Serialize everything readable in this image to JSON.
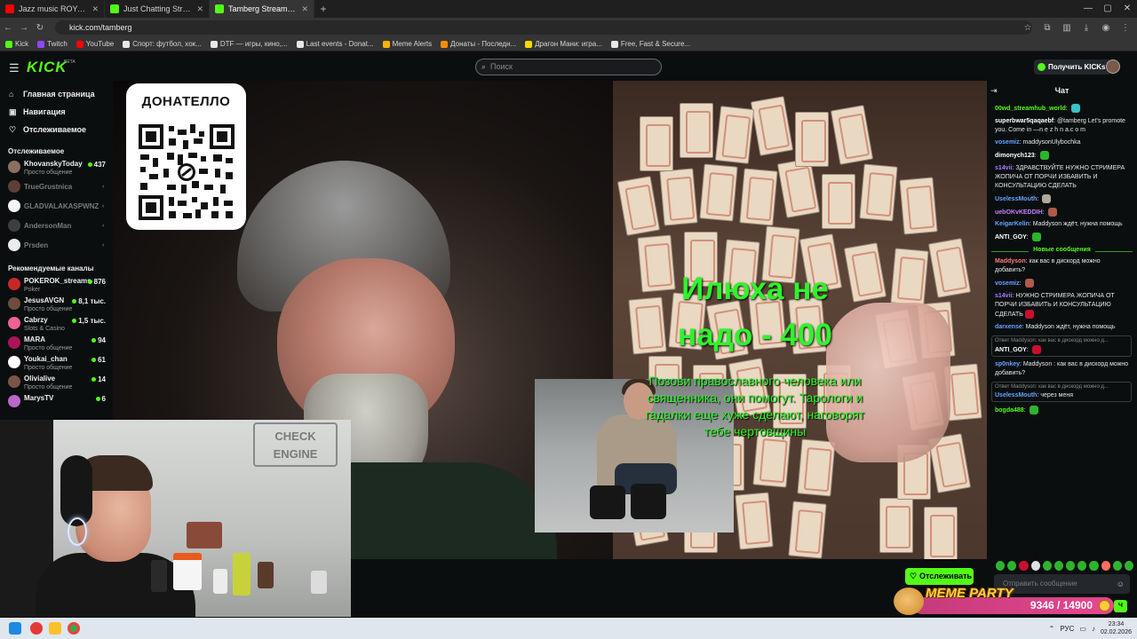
{
  "browser": {
    "tabs": [
      {
        "label": "Jazz music ROYALTY FREE I",
        "color": "#ff0000",
        "active": false
      },
      {
        "label": "Just Chatting Streaming - Live",
        "color": "#53fc18",
        "active": false
      },
      {
        "label": "Tamberg Stream - Watch Li",
        "color": "#53fc18",
        "active": true
      }
    ],
    "url": "kick.com/tamberg",
    "bookmarks": [
      {
        "label": "Kick",
        "color": "#53fc18"
      },
      {
        "label": "Twitch",
        "color": "#9146ff"
      },
      {
        "label": "YouTube",
        "color": "#ff0000"
      },
      {
        "label": "Спорт: футбол, хок...",
        "color": "#e8e8e8"
      },
      {
        "label": "DTF — игры, кино,...",
        "color": "#e8e8e8"
      },
      {
        "label": "Last events - Donat...",
        "color": "#e8e8e8"
      },
      {
        "label": "Meme Alerts",
        "color": "#ffb300"
      },
      {
        "label": "Донаты - Последн...",
        "color": "#ff8c00"
      },
      {
        "label": "Драгон Мани: игра...",
        "color": "#ffd700"
      },
      {
        "label": "Free, Fast & Secure...",
        "color": "#e8e8e8"
      }
    ]
  },
  "header": {
    "logo": "KICK",
    "logo_badge": "BETA",
    "search_placeholder": "Поиск",
    "get_kicks": "Получить KICKs"
  },
  "sidebar": {
    "nav": [
      {
        "label": "Главная страница",
        "icon": "home-icon",
        "glyph": "⌂"
      },
      {
        "label": "Навигация",
        "icon": "browse-icon",
        "glyph": "▣"
      },
      {
        "label": "Отслеживаемое",
        "icon": "heart-icon",
        "glyph": "♡"
      }
    ],
    "following_title": "Отслеживаемое",
    "following": [
      {
        "name": "KhovanskyToday",
        "category": "Просто общение",
        "viewers": "437",
        "live": true,
        "color": "#8d6e63"
      },
      {
        "name": "TrueGrustnica",
        "category": "",
        "viewers": "",
        "live": false,
        "color": "#5d4037"
      },
      {
        "name": "GLADVALAKASPWNZ",
        "category": "",
        "viewers": "",
        "live": false,
        "color": "#f5f5f5"
      },
      {
        "name": "AndersonMan",
        "category": "",
        "viewers": "",
        "live": false,
        "color": "#3e3e3e"
      },
      {
        "name": "Prsden",
        "category": "",
        "viewers": "",
        "live": false,
        "color": "#ececec"
      }
    ],
    "recommended_title": "Рекомендуемые каналы",
    "recommended": [
      {
        "name": "POKEROK_streams",
        "category": "Poker",
        "viewers": "876",
        "color": "#c62828"
      },
      {
        "name": "JesusAVGN",
        "category": "Просто общение",
        "viewers": "8,1 тыс.",
        "color": "#6d4c41"
      },
      {
        "name": "Cabrzy",
        "category": "Slots & Casino",
        "viewers": "1,5 тыс.",
        "color": "#f06292"
      },
      {
        "name": "MARA",
        "category": "Просто общение",
        "viewers": "94",
        "color": "#ad1457"
      },
      {
        "name": "Youkai_chan",
        "category": "Просто общение",
        "viewers": "61",
        "color": "#ffffff"
      },
      {
        "name": "Olivialive",
        "category": "Просто общение",
        "viewers": "14",
        "color": "#795548"
      },
      {
        "name": "MarysTV",
        "category": "",
        "viewers": "6",
        "color": "#ba68c8"
      }
    ]
  },
  "stream": {
    "qr_title": "ДОНАТЕЛЛО",
    "overlay_line1": "Илюха не",
    "overlay_line2": "надо  - 400",
    "overlay_sub": "Позови православного человека или священника, они помогут. Тарологи и гадалки еще хуже сделают, наговорят тебе чертовщины",
    "webcam_sign_line1": "CHECK",
    "webcam_sign_line2": "ENGINE",
    "follow_label": "Отслеживать"
  },
  "chat": {
    "title": "Чат",
    "new_messages": "Новые сообщения",
    "messages": [
      {
        "user": "00wd_streamhub_world",
        "color": "#53fc18",
        "text": "",
        "emote": "#3ac1c9"
      },
      {
        "user": "superbwar5qaqaebf",
        "color": "#ffffff",
        "text": "@tamberg Let's promote you. Come in —n e z h n a.c o m",
        "emote": ""
      },
      {
        "user": "vosemiz",
        "color": "#63a4ff",
        "text": "maddysonUlybochka",
        "emote": ""
      },
      {
        "user": "dimonych123",
        "color": "#ffffff",
        "text": "",
        "emote": "#2cb52c"
      },
      {
        "user": "s14vii",
        "color": "#a77cff",
        "text": "ЗДРАВСТВУЙТЕ НУЖНО СТРИМЕРА ЖОПИЧА ОТ ПОРЧИ ИЗБАВИТЬ И КОНСУЛЬТАЦИЮ СДЕЛАТЬ",
        "emote": ""
      },
      {
        "user": "UselessMouth",
        "color": "#63a4ff",
        "text": "",
        "emote": "#b0a89a"
      },
      {
        "user": "uebOKvKEDDIH",
        "color": "#c47cff",
        "text": "",
        "emote": "#b05a4a"
      },
      {
        "user": "KeigarKelin",
        "color": "#63a4ff",
        "text": "Maddyson ждёт, нужна помощь",
        "emote": ""
      },
      {
        "user": "ANTI_GOY",
        "color": "#ffffff",
        "text": "",
        "emote": "#2cb52c"
      }
    ],
    "new": [
      {
        "user": "Maddyson",
        "color": "#ff7b7b",
        "text": "как вас в дискорд можно добавить?",
        "emote": "",
        "reply": ""
      },
      {
        "user": "vosemiz",
        "color": "#63a4ff",
        "text": "",
        "emote": "#b05a4a",
        "reply": ""
      },
      {
        "user": "s14vii",
        "color": "#a77cff",
        "text": "НУЖНО СТРИМЕРА ЖОПИЧА ОТ ПОРЧИ ИЗБАВИТЬ И КОНСУЛЬТАЦИЮ СДЕЛАТЬ",
        "emote": "#c8102e",
        "reply": ""
      },
      {
        "user": "darxense",
        "color": "#63a4ff",
        "text": "Maddyson ждёт, нужна помощь",
        "emote": "",
        "reply": ""
      },
      {
        "user": "ANTI_GOY",
        "color": "#ffffff",
        "text": "",
        "emote": "#c8102e",
        "reply": "Ответ Maddyson: как вас в дискорд можно д..."
      },
      {
        "user": "sp0nkey",
        "color": "#63a4ff",
        "text": "Maddyson : как вас в дискорд можно добавить?",
        "emote": "",
        "reply": ""
      },
      {
        "user": "UselessMouth",
        "color": "#63a4ff",
        "text": "через меня",
        "emote": "",
        "reply": "Ответ Maddyson: как вас в дискорд можно д..."
      },
      {
        "user": "bogda488",
        "color": "#53fc18",
        "text": "",
        "emote": "#2cb52c",
        "reply": ""
      }
    ],
    "input_placeholder": "Отправить сообщение",
    "points_banner": "MEME PARTY",
    "points_value": "9346 / 14900"
  },
  "taskbar": {
    "lang": "РУС",
    "time": "23:34",
    "date": "02.02.2026"
  }
}
